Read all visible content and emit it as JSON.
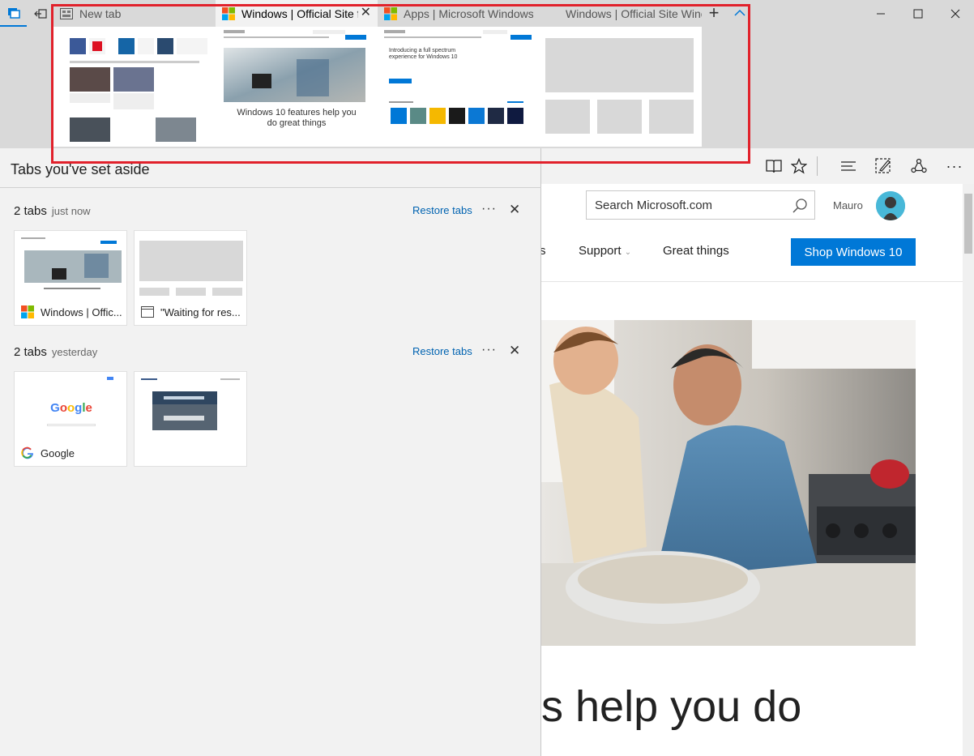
{
  "tabs": [
    {
      "label": "New tab",
      "icon": "new-tab-icon",
      "active": false
    },
    {
      "label": "Windows | Official Site f",
      "icon": "microsoft-logo-icon",
      "active": true
    },
    {
      "label": "Apps | Microsoft Windows",
      "icon": "microsoft-logo-icon",
      "active": false
    },
    {
      "label": "Windows | Official Site Winc",
      "icon": "none",
      "active": false
    }
  ],
  "previews": {
    "windows_text": "Windows 10 features help you do great things",
    "apps_text": "Introducing a full spectrum experience for Windows 10"
  },
  "panel": {
    "title": "Tabs you've set aside",
    "groups": [
      {
        "count": "2 tabs",
        "when": "just now",
        "restore": "Restore tabs",
        "cards": [
          {
            "title": "Windows | Offic...",
            "icon": "microsoft-logo-icon"
          },
          {
            "title": "\"Waiting for res...",
            "icon": "page-icon"
          }
        ]
      },
      {
        "count": "2 tabs",
        "when": "yesterday",
        "restore": "Restore tabs",
        "cards": [
          {
            "title": "Google",
            "icon": "google-logo-icon",
            "thumb_text": "Google"
          },
          {
            "title": "",
            "icon": "none"
          }
        ]
      }
    ]
  },
  "page": {
    "search_placeholder": "Search Microsoft.com",
    "user": "Mauro",
    "nav": [
      "s",
      "Support",
      "Great things"
    ],
    "shop": "Shop Windows 10",
    "headline": "s help you do"
  },
  "colors": {
    "accent": "#0078d7",
    "highlight": "#e1212b",
    "chrome": "#d9d9d9"
  }
}
